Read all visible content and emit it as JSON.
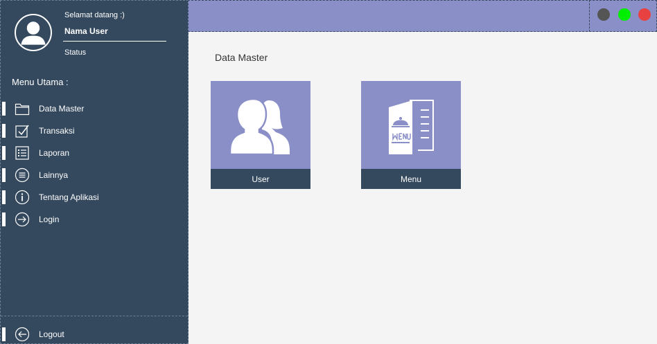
{
  "user": {
    "greeting": "Selamat datang :)",
    "name": "Nama User",
    "status": "Status"
  },
  "sidebar": {
    "menu_title": "Menu Utama :",
    "items": [
      {
        "label": "Data Master",
        "icon": "folder-icon"
      },
      {
        "label": "Transaksi",
        "icon": "checkbox-icon"
      },
      {
        "label": "Laporan",
        "icon": "list-icon"
      },
      {
        "label": "Lainnya",
        "icon": "menu-circle-icon"
      },
      {
        "label": "Tentang Aplikasi",
        "icon": "info-icon"
      },
      {
        "label": "Login",
        "icon": "login-icon"
      }
    ],
    "logout": {
      "label": "Logout",
      "icon": "logout-icon"
    }
  },
  "window_controls": {
    "minimize_color": "#555555",
    "maximize_color": "#00ee00",
    "close_color": "#e84141"
  },
  "main": {
    "title": "Data Master",
    "tiles": [
      {
        "label": "User",
        "icon": "users-icon"
      },
      {
        "label": "Menu",
        "icon": "menu-book-icon"
      }
    ]
  },
  "colors": {
    "sidebar_bg": "#34495e",
    "accent": "#8b8fc8",
    "content_bg": "#f4f4f4"
  }
}
